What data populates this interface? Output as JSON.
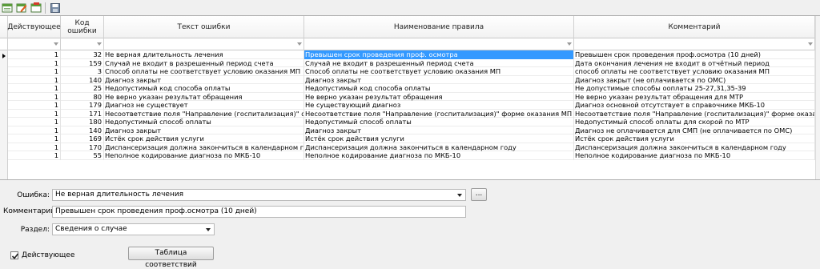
{
  "toolbar": {
    "icons": [
      "add-record-icon",
      "edit-record-icon",
      "delete-record-icon",
      "save-icon"
    ]
  },
  "grid": {
    "columns": [
      "Действующее",
      "Код ошибки",
      "Текст ошибки",
      "Наименование правила",
      "Комментарий"
    ],
    "rows": [
      {
        "active": "1",
        "code": "32",
        "text": "Не верная длительность лечения",
        "rule": "Превышен срок проведения проф. осмотра",
        "comment": "Превышен срок проведения проф.осмотра (10 дней)"
      },
      {
        "active": "1",
        "code": "159",
        "text": "Случай не входит в разрешенный период счета",
        "rule": "Случай не входит в разрешенный период счета",
        "comment": "Дата окончания лечения не входит в отчётный период"
      },
      {
        "active": "1",
        "code": "3",
        "text": "Способ оплаты не соответствует условию оказания МП",
        "rule": "Способ оплаты не соответствует условию оказания МП",
        "comment": "способ оплаты не соответствует условию оказания МП"
      },
      {
        "active": "1",
        "code": "140",
        "text": "Диагноз закрыт",
        "rule": "Диагноз закрыт",
        "comment": "Диагноз закрыт (не оплачивается по ОМС)"
      },
      {
        "active": "1",
        "code": "25",
        "text": "Недопустимый код способа оплаты",
        "rule": "Недопустимый код способа оплаты",
        "comment": "Не допустимые способы ооплаты 25-27,31,35-39"
      },
      {
        "active": "1",
        "code": "80",
        "text": "Не верно указан результат обращения",
        "rule": "Не верно указан результат обращения",
        "comment": "Не верно указан результат обращения для МТР"
      },
      {
        "active": "1",
        "code": "179",
        "text": "Диагноз не существует",
        "rule": "Не существующий диагноз",
        "comment": "Диагноз основной отсутствует в справочнике МКБ-10"
      },
      {
        "active": "1",
        "code": "171",
        "text": "Несоответствие поля \"Направление (госпитализация)\" форме",
        "rule": "Несоответствие поля \"Направление (госпитализация)\" форме оказания МП",
        "comment": "Несоответствие поля \"Направление (госпитализация)\" форме оказания МП"
      },
      {
        "active": "1",
        "code": "180",
        "text": "Недопустимый способ оплаты",
        "rule": "Недопустимый способ оплаты",
        "comment": "Недопустимый способ оплаты для скорой по МТР"
      },
      {
        "active": "1",
        "code": "140",
        "text": "Диагноз закрыт",
        "rule": "Диагноз закрыт",
        "comment": "Диагноз не оплачивается для СМП (не оплачивается по ОМС)"
      },
      {
        "active": "1",
        "code": "169",
        "text": "Истёк срок действия услуги",
        "rule": "Истёк срок действия услуги",
        "comment": "Истёк срок действия услуги"
      },
      {
        "active": "1",
        "code": "170",
        "text": "Диспансеризация должна закончиться в календарном году",
        "rule": "Диспансеризация должна закончиться в календарном году",
        "comment": "Диспансеризация должна закончиться в календарном году"
      },
      {
        "active": "1",
        "code": "55",
        "text": "Неполное кодирование диагноза по МКБ-10",
        "rule": "Неполное кодирование диагноза по МКБ-10",
        "comment": "Неполное кодирование диагноза по МКБ-10"
      }
    ]
  },
  "form": {
    "error_label": "Ошибка:",
    "error_value": "Не верная длительность лечения",
    "ellipsis_label": "...",
    "comment_label": "Комментарий:",
    "comment_value": "Превышен срок проведения проф.осмотра (10 дней)",
    "section_label": "Раздел:",
    "section_value": "Сведения о случае",
    "active_label": "Действующее",
    "active_checked": true,
    "mapping_button": "Таблица соответствий"
  }
}
